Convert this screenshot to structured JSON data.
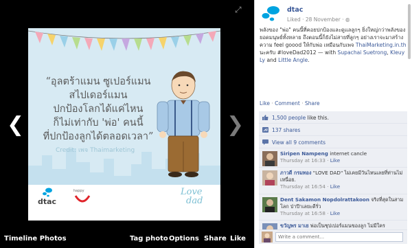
{
  "viewer": {
    "prev_arrow": "❮",
    "next_arrow": "❯",
    "fullscreen_icon": "⤢",
    "photo": {
      "quote_lines": [
        "“อุลตร้าแมน ซูเปอร์แมน",
        "สไปเดอร์แมน",
        "ปกป้องโลกได้แค่ไหน",
        "ก็ไม่เท่ากับ 'พ่อ' คนนี้",
        "ที่ปกป้องลูกได้ตลอดเวลา”"
      ],
      "credit": "Credit: เพจ Thaimarketing",
      "brand": "dtac",
      "happy_label": "happy",
      "love_line1": "Love",
      "love_line2": "dad"
    },
    "bottom_bar": {
      "album": "Timeline Photos",
      "tag_photo": "Tag photo",
      "options": "Options",
      "share": "Share",
      "like": "Like"
    }
  },
  "post": {
    "author": "dtac",
    "meta": "Liked · 28 November · ",
    "text_main": "พลังของ \"พ่อ\" คนนี้ที่คอยปกป้องและดูแลลูกๆ ยิ่งใหญ่กว่าพลังของยอดมนุษย์ทั้งหลาย ถึงตอนนี้ก็ยังไม่สายที่ลูกๆ อย่างเราจะมาสร้างความ feel goood ให้กับพ่อ เหมือนกับเพจ ",
    "text_link": "ThaiMarketing.in.th",
    "text_after": " นะครับ #loveDad2012 — with ",
    "tag_1": "Supachai Suetrong",
    "tag_sep": ", ",
    "tag_2": "Kleuy Ly",
    "tag_and": " and ",
    "tag_3": "Little Angle",
    "tag_end": ".",
    "actions": {
      "like": "Like",
      "comment": "Comment",
      "share": "Share",
      "dot": " · "
    }
  },
  "ufi": {
    "likes_count": "1,500 people",
    "likes_suffix": " like this.",
    "shares": "137 shares",
    "view_all": "View all 9 comments"
  },
  "comments": [
    {
      "name": "Siripen Nampeng",
      "text": " internet cancle",
      "time": "Thursday at 16:33",
      "like": "Like"
    },
    {
      "name": "ภาวดี กรมทอง",
      "text": " \"LOVE DAD\" ไม่เคยมีวันไหนเลยที่ท่านไม่เหนื่อย.",
      "time": "Thursday at 16:54",
      "like": "Like"
    },
    {
      "name": "Dent Sakamon Nopdolrattakoon",
      "text": " จริงที่สุดในสามโลก ป่าป๊าเลยะดีรั่ว",
      "time": "Thursday at 16:58",
      "like": "Like"
    },
    {
      "name": "ขวัญพร มาเย",
      "text": " พ่อเป็นซุปเปอร์แมนของลูก ไม่มีใคร",
      "time": "",
      "like": ""
    }
  ],
  "write_comment": {
    "placeholder": "Write a comment..."
  },
  "colors": {
    "brand_blue": "#00a3e0",
    "fb_link": "#3b5998",
    "ufi_bg": "#edeff4"
  }
}
